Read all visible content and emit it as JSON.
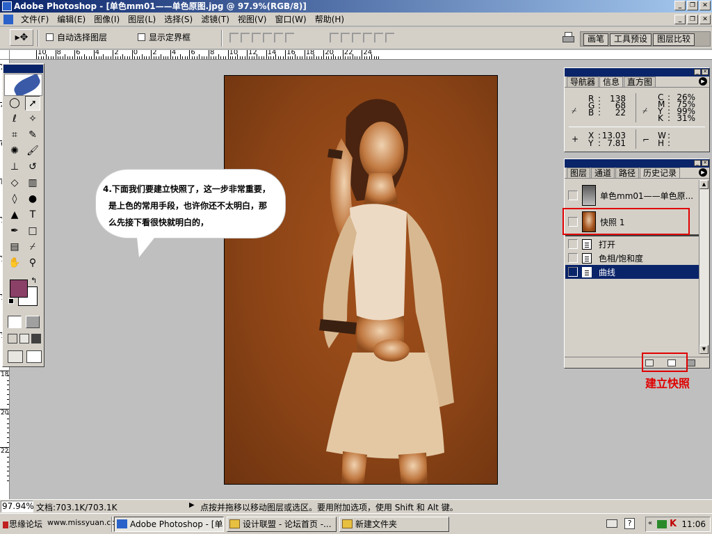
{
  "window": {
    "title": "Adobe Photoshop - [单色mm01——单色原图.jpg @ 97.9%(RGB/8)]"
  },
  "menu": [
    "文件(F)",
    "编辑(E)",
    "图像(I)",
    "图层(L)",
    "选择(S)",
    "滤镜(T)",
    "视图(V)",
    "窗口(W)",
    "帮助(H)"
  ],
  "options": {
    "auto_select_label": "自动选择图层",
    "show_bounds_label": "显示定界框"
  },
  "palette_well": {
    "tabs": [
      "画笔",
      "工具预设",
      "图层比较"
    ]
  },
  "ruler": {
    "h_labels": [
      "10",
      "8",
      "6",
      "4",
      "2",
      "0",
      "2",
      "4",
      "6",
      "8",
      "10",
      "12",
      "14",
      "16",
      "18",
      "20",
      "22",
      "24"
    ],
    "v_labels": [
      "2",
      "4",
      "6",
      "8",
      "10",
      "12",
      "14",
      "16",
      "18",
      "20",
      "22"
    ]
  },
  "bubble": {
    "line1": "4.下面我们要建立快照了，这一步非常重要，",
    "line2": "是上色的常用手段，也许你还不太明白，那",
    "line3": "么先接下看很快就明白的，"
  },
  "info_palette": {
    "tabs": [
      "导航器",
      "信息",
      "直方图"
    ],
    "rgb": {
      "R": "138",
      "G": "68",
      "B": "22"
    },
    "cmyk": {
      "C": "26%",
      "M": "75%",
      "Y": "99%",
      "K": "31%"
    },
    "xy": {
      "X": "13.03",
      "Y": "7.81"
    },
    "wh": {
      "W": "",
      "H": ""
    }
  },
  "history_palette": {
    "tabs": [
      "图层",
      "通道",
      "路径",
      "历史记录"
    ],
    "source_label": "单色mm01——单色原...",
    "snapshot_label": "快照 1",
    "steps": [
      "打开",
      "色相/饱和度",
      "曲线"
    ]
  },
  "annotation": {
    "label": "建立快照"
  },
  "status": {
    "zoom": "97.94%",
    "doc": "文档:703.1K/703.1K",
    "message": "点按并拖移以移动图层或选区。要用附加选项，使用 Shift 和 Alt 键。"
  },
  "taskbar": {
    "quicklaunch": [
      "思缘论坛",
      "www.missyuan.com"
    ],
    "tasks": [
      "Adobe Photoshop - [单...",
      "设计联盟 - 论坛首页 -...",
      "新建文件夹"
    ],
    "clock": "11:06"
  },
  "colors": {
    "foreground": "#8b4068",
    "background": "#ffffff",
    "canvas": "#8c4416",
    "annotation": "#e00000",
    "selection": "#0a246a"
  }
}
